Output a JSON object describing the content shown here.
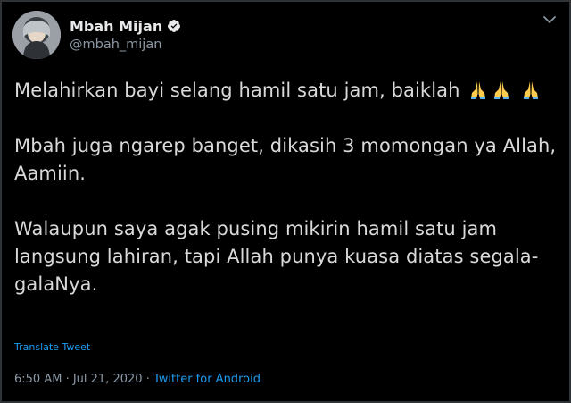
{
  "user": {
    "display_name": "Mbah Mijan",
    "handle": "@mbah_mijan",
    "verified": true
  },
  "tweet": {
    "paragraphs": [
      {
        "text": "Melahirkan bayi selang hamil satu jam, baiklah ",
        "emoji_after": [
          "folded-hands",
          "folded-hands",
          "folded-hands"
        ]
      },
      {
        "text": "Mbah juga ngarep banget, dikasih 3 momongan ya Allah, Aamiin."
      },
      {
        "text": "Walaupun saya agak pusing mikirin hamil satu jam langsung lahiran, tapi Allah punya kuasa diatas segala-galaNya."
      }
    ],
    "translate_label": "Translate Tweet",
    "time": "6:50 AM",
    "separator": " · ",
    "date": "Jul 21, 2020",
    "source": "Twitter for Android"
  },
  "colors": {
    "background": "#000000",
    "text": "#d9d9d9",
    "secondary": "#8b98a5",
    "accent": "#1d9bf0"
  }
}
